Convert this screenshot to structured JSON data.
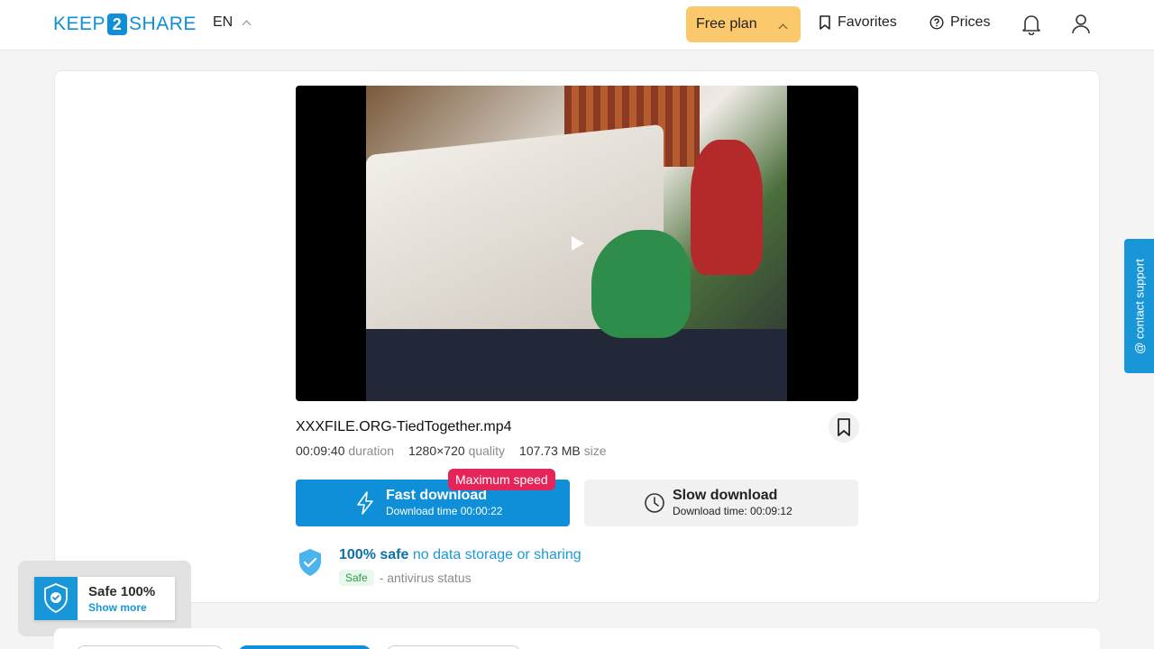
{
  "header": {
    "logo_left": "KEEP",
    "logo_mid": "2",
    "logo_right": "SHARE",
    "language": "EN",
    "plan_label": "Free plan",
    "favorites_label": "Favorites",
    "prices_label": "Prices"
  },
  "file": {
    "name": "XXXFILE.ORG-TiedTogether.mp4",
    "duration": "00:09:40",
    "duration_label": "duration",
    "quality": "1280×720",
    "quality_label": "quality",
    "size": "107.73 MB",
    "size_label": "size"
  },
  "download": {
    "max_speed_badge": "Maximum speed",
    "fast_title": "Fast download",
    "fast_sub": "Download time 00:00:22",
    "slow_title": "Slow download",
    "slow_sub": "Download time: 00:09:12"
  },
  "safety": {
    "safe_strong": "100% safe",
    "safe_rest": "no data storage or sharing",
    "tag": "Safe",
    "status_text": "- antivirus status"
  },
  "widget": {
    "title": "Safe 100%",
    "link": "Show more"
  },
  "contact": {
    "label": "@ contact support"
  },
  "colors": {
    "accent": "#0f8fd8",
    "plan": "#fbc96b",
    "badge": "#e5255a"
  }
}
